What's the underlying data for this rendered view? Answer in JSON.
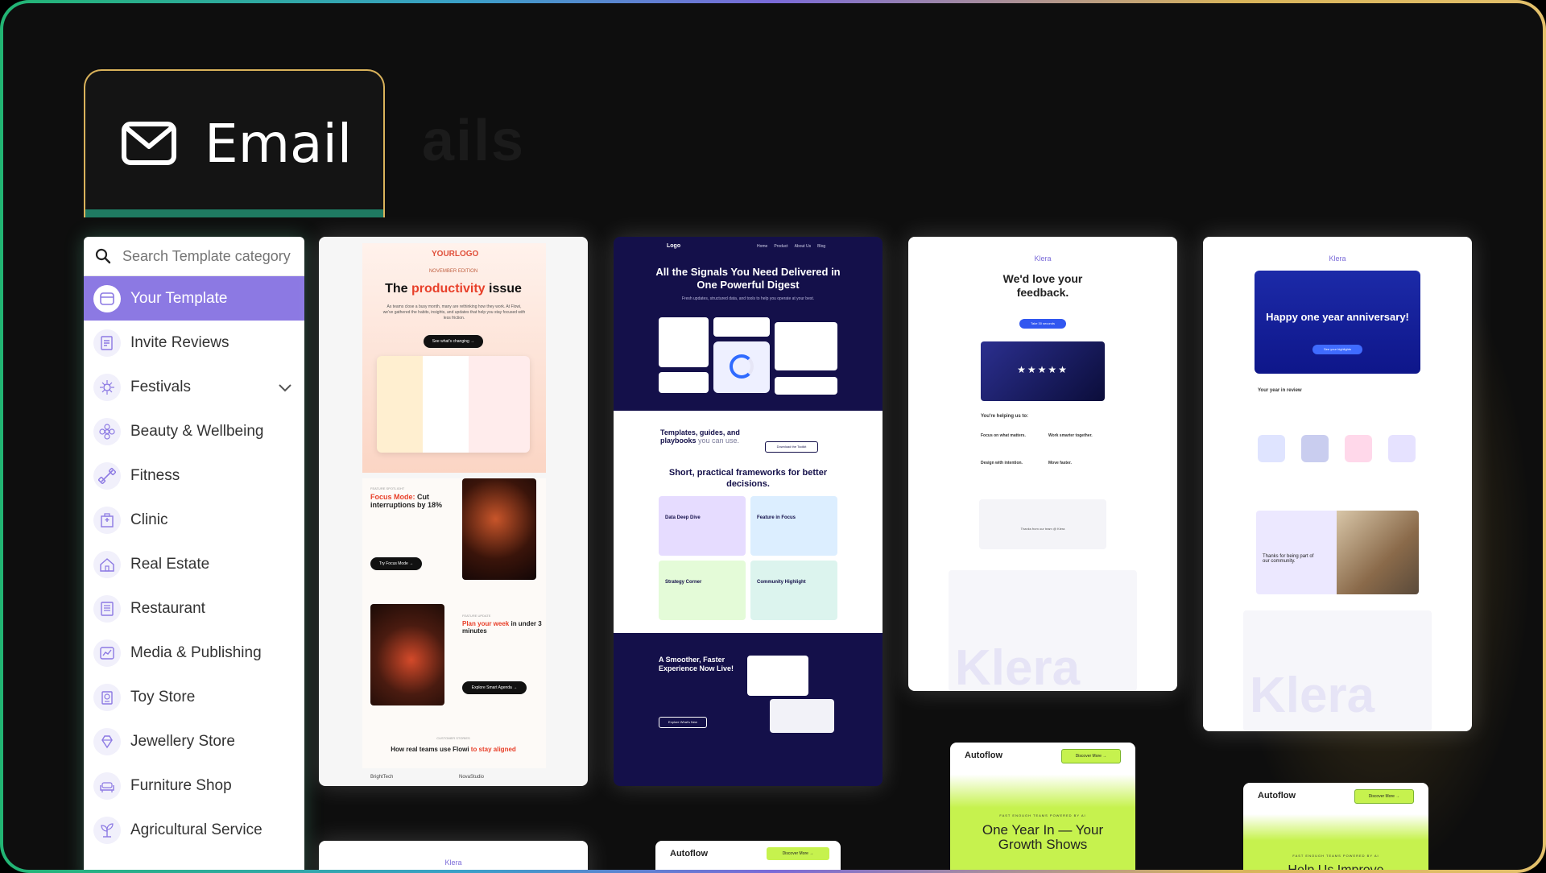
{
  "header": {
    "tab_label": "Email",
    "ghost_text": "ails"
  },
  "search": {
    "placeholder": "Search Template category"
  },
  "sidebar": {
    "items": [
      {
        "label": "Your Template",
        "icon": "template-icon",
        "active": true
      },
      {
        "label": "Invite Reviews",
        "icon": "review-icon"
      },
      {
        "label": "Festivals",
        "icon": "festival-icon",
        "expandable": true
      },
      {
        "label": "Beauty & Wellbeing",
        "icon": "flower-icon"
      },
      {
        "label": "Fitness",
        "icon": "dumbbell-icon"
      },
      {
        "label": "Clinic",
        "icon": "hospital-icon"
      },
      {
        "label": "Real Estate",
        "icon": "house-icon"
      },
      {
        "label": "Restaurant",
        "icon": "restaurant-icon"
      },
      {
        "label": "Media & Publishing",
        "icon": "chart-icon"
      },
      {
        "label": "Toy Store",
        "icon": "toy-icon"
      },
      {
        "label": "Jewellery Store",
        "icon": "jewellery-icon"
      },
      {
        "label": "Furniture Shop",
        "icon": "sofa-icon"
      },
      {
        "label": "Agricultural Service",
        "icon": "plant-icon"
      }
    ]
  },
  "templates": {
    "t1": {
      "logo": "YOURLOGO",
      "edition": "NOVEMBER EDITION",
      "title_a": "The ",
      "title_b": "productivity",
      "title_c": " issue",
      "intro": "As teams close a busy month, many are rethinking how they work. At Flowi, we've gathered the habits, insights, and updates that help you stay focused with less friction.",
      "cta": "See what's changing →",
      "spot_tag": "FEATURE SPOTLIGHT",
      "spot_title_a": "Focus Mode:",
      "spot_title_b": " Cut interruptions by 18%",
      "spot_cta": "Try Focus Mode →",
      "feat_tag": "FEATURE UPDATE",
      "feat_title_a": "Plan your week",
      "feat_title_b": " in under 3 minutes",
      "feat_cta": "Explore Smart Agenda →",
      "stories_tag": "CUSTOMER STORIES",
      "stories_a": "How real teams use Flowi ",
      "stories_b": "to stay aligned",
      "brand1": "BrightTech",
      "brand2": "NovaStudio"
    },
    "t2": {
      "logo": "Logo",
      "nav": [
        "Home",
        "Product",
        "About Us",
        "Blog"
      ],
      "title": "All the Signals You Need Delivered in One Powerful Digest",
      "sub": "Fresh updates, structured data, and tools to help you operate at your best.",
      "mid_title_a": "Templates, guides, and playbooks",
      "mid_title_b": " you can use.",
      "mid_cta": "Download the Toolkit",
      "fw_title": "Short, practical frameworks for better decisions.",
      "tiles": [
        "Data Deep Dive",
        "Feature in Focus",
        "Strategy Corner",
        "Community Highlight"
      ],
      "bottom_title": "A Smoother, Faster Experience Now Live!",
      "bottom_cta": "Explore What's New"
    },
    "t3": {
      "brand": "Klera",
      "title": "We'd love your feedback.",
      "cta": "Take 30 seconds",
      "stars": "★★★★★",
      "helping": "You're helping us to:",
      "points": [
        "Focus on what matters.",
        "Work smarter together.",
        "Design with intention.",
        "Move faster."
      ],
      "thanks": "Thanks from our team @ Klera",
      "watermark": "Klera"
    },
    "t4": {
      "brand": "Klera",
      "title": "Happy one year anniversary!",
      "cta": "See your highlights",
      "review": "Your year in review",
      "community": "Thanks for being part of our community.",
      "watermark": "Klera"
    },
    "t5": {
      "brand": "Klera"
    },
    "t6": {
      "brand": "Autoflow",
      "cta": "Discover More →"
    },
    "t7": {
      "brand": "Autoflow",
      "cta": "Discover More →",
      "tag": "FAST ENOUGH TEAMS POWERED BY AI",
      "title": "One Year In — Your Growth Shows"
    },
    "t8": {
      "brand": "Autoflow",
      "cta": "Discover More →",
      "tag": "FAST ENOUGH TEAMS POWERED BY AI",
      "title": "Help Us Improve"
    }
  },
  "colors": {
    "accent": "#8c79e3",
    "tab_border": "#d9b25b",
    "tab_bar": "#1f7a62",
    "lime": "#c6f24e",
    "navy": "#14104a"
  }
}
